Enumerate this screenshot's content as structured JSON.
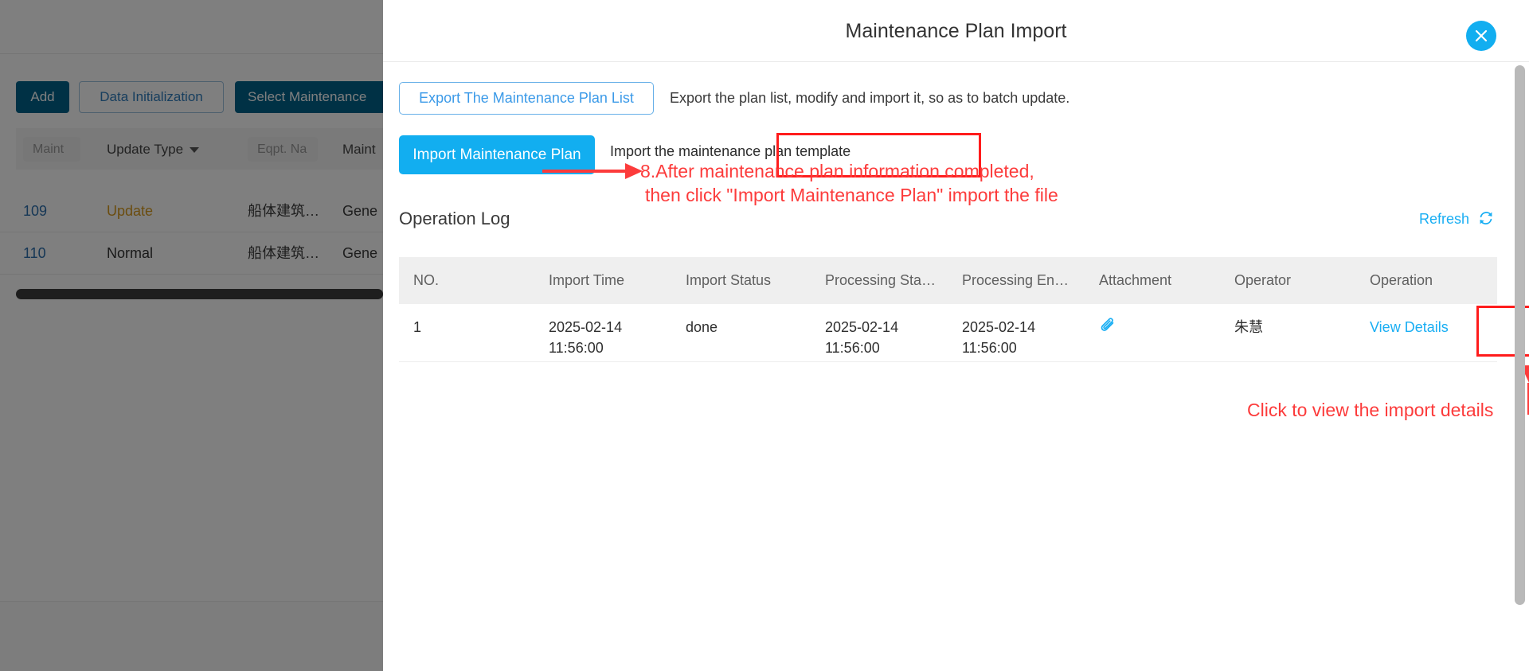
{
  "background_page": {
    "toolbar": {
      "add_label": "Add",
      "data_init_label": "Data Initialization",
      "select_maintenance_label": "Select Maintenance"
    },
    "filters": {
      "maint_placeholder": "Maint",
      "update_type_label": "Update Type",
      "eqpt_name_placeholder": "Eqpt. Na",
      "maint_label": "Maint"
    },
    "rows": [
      {
        "id": "109",
        "update_type": "Update",
        "equipment": "船体建筑…",
        "category": "Gene"
      },
      {
        "id": "110",
        "update_type": "Normal",
        "equipment": "船体建筑…",
        "category": "Gene"
      }
    ]
  },
  "modal": {
    "title": "Maintenance Plan Import",
    "close_icon": "close-icon",
    "export_button_label": "Export The Maintenance Plan List",
    "export_description": "Export the plan list, modify and import it, so as to batch update.",
    "import_button_label": "Import Maintenance Plan",
    "import_description": "Import the maintenance plan template",
    "operation_log_title": "Operation Log",
    "refresh_label": "Refresh",
    "refresh_icon": "refresh-icon",
    "table": {
      "columns": [
        "NO.",
        "Import Time",
        "Import Status",
        "Processing Sta…",
        "Processing En…",
        "Attachment",
        "Operator",
        "Operation"
      ],
      "rows": [
        {
          "no": "1",
          "import_time": "2025-02-14 11:56:00",
          "import_status": "done",
          "processing_start": "2025-02-14 11:56:00",
          "processing_end": "2025-02-14 11:56:00",
          "attachment_icon": "paperclip-icon",
          "operator": "朱慧",
          "operation": "View Details"
        }
      ]
    }
  },
  "annotations": [
    {
      "id": "step-8",
      "line1": "8.After maintenance plan information completed,",
      "line2": "then click \"Import Maintenance Plan\" import the file"
    },
    {
      "id": "view-details-hint",
      "text": "Click to view the import details"
    }
  ],
  "colors": {
    "accent_blue": "#12AEF0",
    "link_blue": "#19AEF3",
    "annotation_red": "#FC3B3B",
    "highlight_red": "#FF1C1C",
    "dark_blue_button": "#00628B",
    "header_grey": "#EFEFEF"
  }
}
